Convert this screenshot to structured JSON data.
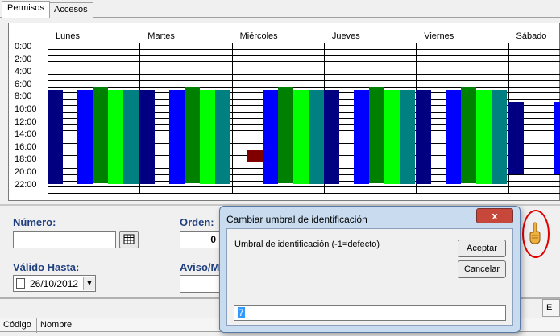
{
  "tabs": [
    {
      "label": "Permisos",
      "active": true
    },
    {
      "label": "Accesos",
      "active": false
    }
  ],
  "schedule": {
    "days": [
      "Lunes",
      "Martes",
      "Miércoles",
      "Jueves",
      "Viernes",
      "Sábado"
    ],
    "hours": [
      "0:00",
      "2:00",
      "4:00",
      "6:00",
      "8:00",
      "10:00",
      "12:00",
      "14:00",
      "16:00",
      "18:00",
      "20:00",
      "22:00"
    ],
    "colors": {
      "navy": "#000080",
      "blue": "#0000ff",
      "green": "#008000",
      "lime": "#00ff00",
      "teal": "#008080",
      "darkred": "#800000"
    },
    "blocks": [
      {
        "day": 0,
        "slot": 0,
        "color": "navy",
        "start": 7.5,
        "end": 22.5
      },
      {
        "day": 0,
        "slot": 1,
        "color": "blue",
        "start": 7.5,
        "end": 22.5
      },
      {
        "day": 0,
        "slot": 2,
        "color": "green",
        "start": 7,
        "end": 22.5
      },
      {
        "day": 0,
        "slot": 3,
        "color": "lime",
        "start": 7.5,
        "end": 22.5
      },
      {
        "day": 0,
        "slot": 4,
        "color": "teal",
        "start": 7.5,
        "end": 22.5
      },
      {
        "day": 1,
        "slot": 0,
        "color": "navy",
        "start": 7.5,
        "end": 22.5
      },
      {
        "day": 1,
        "slot": 1,
        "color": "blue",
        "start": 7.5,
        "end": 22.5
      },
      {
        "day": 1,
        "slot": 2,
        "color": "green",
        "start": 7,
        "end": 22.5
      },
      {
        "day": 1,
        "slot": 3,
        "color": "lime",
        "start": 7.5,
        "end": 22.5
      },
      {
        "day": 1,
        "slot": 4,
        "color": "teal",
        "start": 7.5,
        "end": 22.5
      },
      {
        "day": 2,
        "slot": 1,
        "color": "darkred",
        "start": 17,
        "end": 19
      },
      {
        "day": 2,
        "slot": 2,
        "color": "blue",
        "start": 7.5,
        "end": 22.5
      },
      {
        "day": 2,
        "slot": 3,
        "color": "green",
        "start": 7,
        "end": 22.5
      },
      {
        "day": 2,
        "slot": 4,
        "color": "lime",
        "start": 7.5,
        "end": 22.5
      },
      {
        "day": 2,
        "slot": 5,
        "color": "teal",
        "start": 7.5,
        "end": 22.5
      },
      {
        "day": 3,
        "slot": 0,
        "color": "navy",
        "start": 7.5,
        "end": 22.5
      },
      {
        "day": 3,
        "slot": 1,
        "color": "blue",
        "start": 7.5,
        "end": 22.5
      },
      {
        "day": 3,
        "slot": 2,
        "color": "green",
        "start": 7,
        "end": 22.5
      },
      {
        "day": 3,
        "slot": 3,
        "color": "lime",
        "start": 7.5,
        "end": 22.5
      },
      {
        "day": 3,
        "slot": 4,
        "color": "teal",
        "start": 7.5,
        "end": 22.5
      },
      {
        "day": 4,
        "slot": 0,
        "color": "navy",
        "start": 7.5,
        "end": 22.5
      },
      {
        "day": 4,
        "slot": 1,
        "color": "blue",
        "start": 7.5,
        "end": 22.5
      },
      {
        "day": 4,
        "slot": 2,
        "color": "green",
        "start": 7,
        "end": 22.5
      },
      {
        "day": 4,
        "slot": 3,
        "color": "lime",
        "start": 7.5,
        "end": 22.5
      },
      {
        "day": 4,
        "slot": 4,
        "color": "teal",
        "start": 7.5,
        "end": 22.5
      },
      {
        "day": 5,
        "slot": 0,
        "color": "navy",
        "start": 9.5,
        "end": 21
      },
      {
        "day": 5,
        "slot": 2,
        "color": "blue",
        "start": 9.5,
        "end": 21
      },
      {
        "day": 5,
        "slot": 3,
        "color": "green",
        "start": 9,
        "end": 21
      }
    ]
  },
  "form": {
    "numero_label": "Número:",
    "orden_label": "Orden:",
    "orden_value": "0",
    "valido_label": "Válido Hasta:",
    "valido_value": "26/10/2012",
    "aviso_label": "Aviso/M",
    "right_label": "E"
  },
  "grid": {
    "columns": [
      "Código",
      "Nombre"
    ]
  },
  "dialog": {
    "title": "Cambiar umbral de identificación",
    "close": "x",
    "prompt": "Umbral de identificación (-1=defecto)",
    "ok": "Aceptar",
    "cancel": "Cancelar",
    "value": "7"
  }
}
